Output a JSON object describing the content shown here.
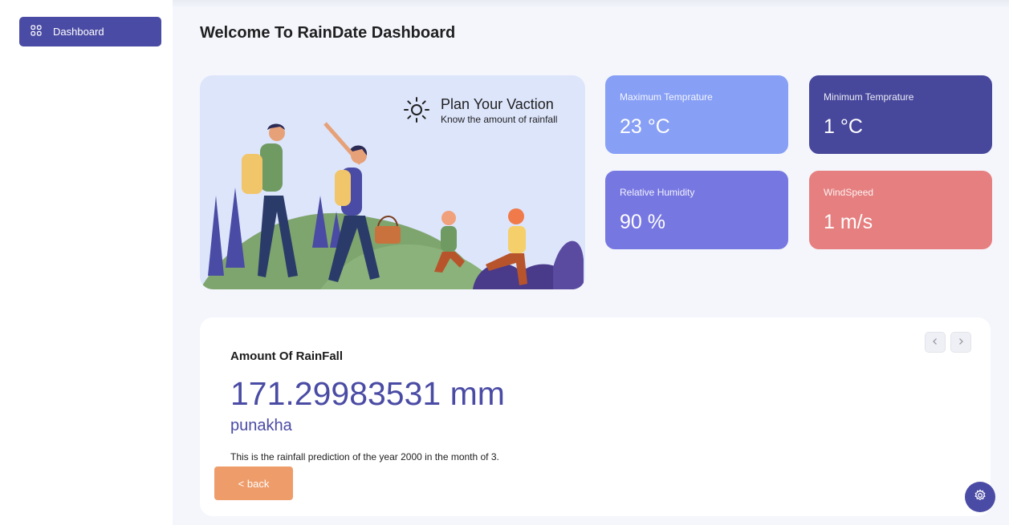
{
  "sidebar": {
    "items": [
      {
        "label": "Dashboard",
        "icon": "grid-icon"
      }
    ]
  },
  "header": {
    "title": "Welcome To RainDate Dashboard"
  },
  "hero": {
    "title": "Plan Your Vaction",
    "subtitle": "Know the amount of rainfall",
    "icon": "sun-icon"
  },
  "stats": [
    {
      "label": "Maximum Temprature",
      "value": "23 °C",
      "color": "#879ff5"
    },
    {
      "label": "Minimum Temprature",
      "value": "1 °C",
      "color": "#47479c"
    },
    {
      "label": "Relative Humidity",
      "value": "90 %",
      "color": "#7777e2"
    },
    {
      "label": "WindSpeed",
      "value": "1 m/s",
      "color": "#e67f7f"
    }
  ],
  "rainfall": {
    "heading": "Amount Of RainFall",
    "value": "171.29983531 mm",
    "place": "punakha",
    "note": "This is the rainfall prediction of the year 2000 in the month of 3.",
    "back_label": "< back"
  },
  "colors": {
    "accent": "#4a4ba4",
    "back_button": "#ee9c6a",
    "background": "#f4f6fc"
  }
}
